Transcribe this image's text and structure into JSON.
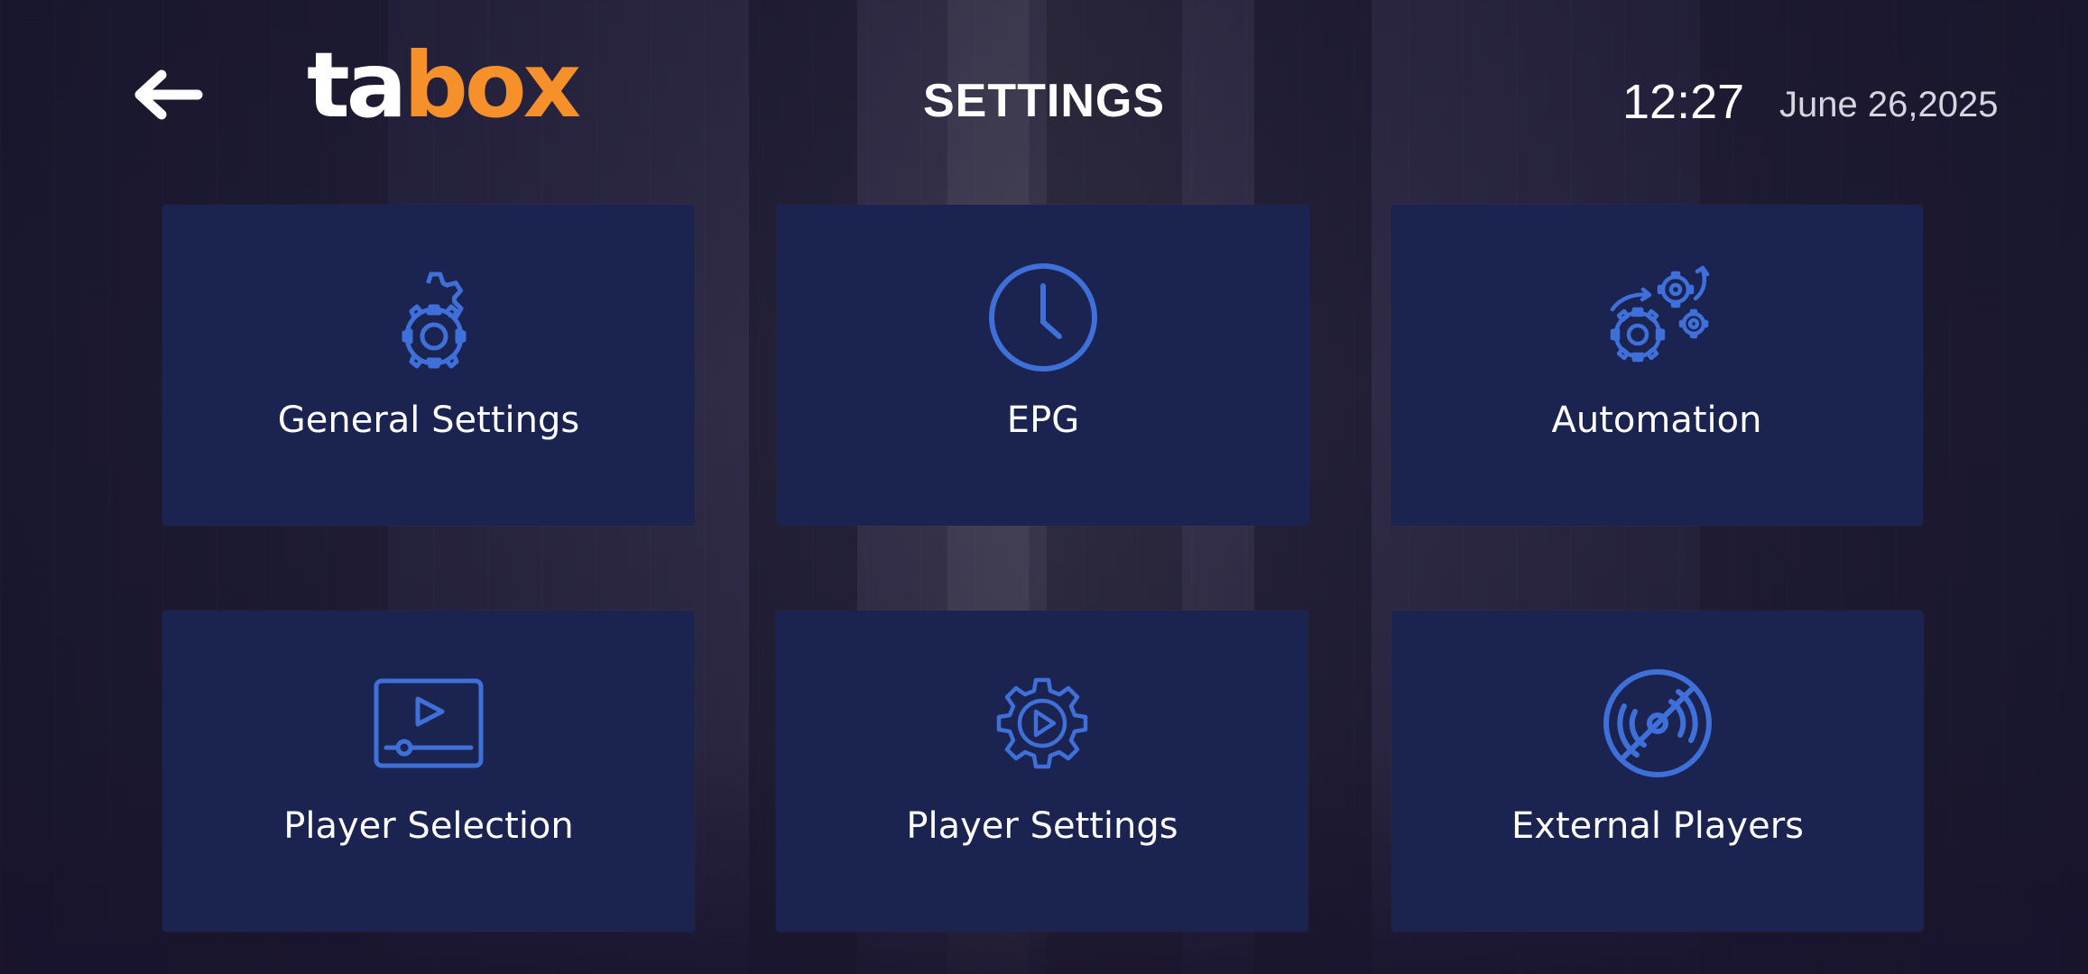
{
  "colors": {
    "accent": "#3f6fd8",
    "tile_bg": "#1b2350",
    "brand_orange": "#f5902a",
    "text": "#ffffff"
  },
  "header": {
    "back_icon": "arrow-left-icon",
    "logo": {
      "part1": "ta",
      "part2": "box"
    },
    "title": "SETTINGS",
    "time": "12:27",
    "date": "June 26,2025"
  },
  "tiles": [
    {
      "label": "General Settings",
      "icon": "gears-icon"
    },
    {
      "label": "EPG",
      "icon": "clock-icon"
    },
    {
      "label": "Automation",
      "icon": "automation-gears-icon"
    },
    {
      "label": "Player Selection",
      "icon": "video-player-icon"
    },
    {
      "label": "Player Settings",
      "icon": "play-gear-icon"
    },
    {
      "label": "External Players",
      "icon": "disc-off-icon"
    }
  ]
}
